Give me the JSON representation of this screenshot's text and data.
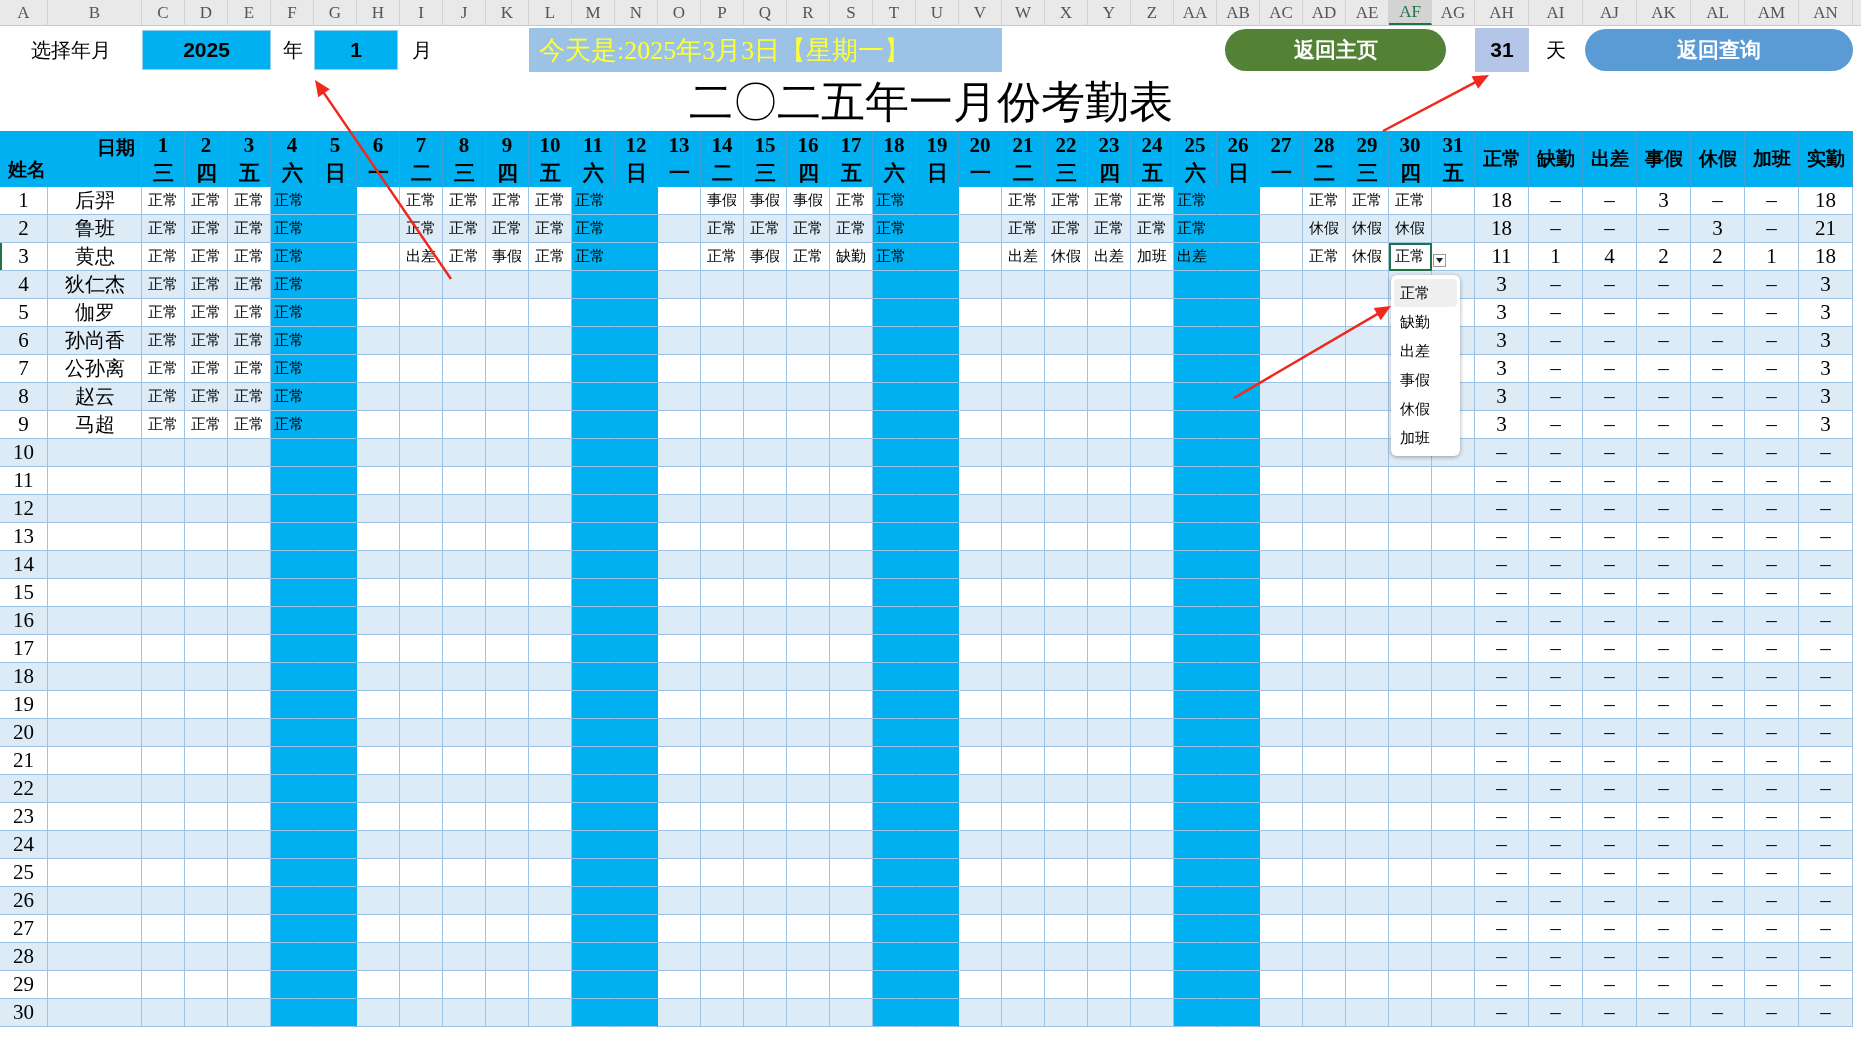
{
  "column_letters": [
    {
      "label": "A",
      "selected": false
    },
    {
      "label": "B",
      "selected": false
    },
    {
      "label": "C",
      "selected": false
    },
    {
      "label": "D",
      "selected": false
    },
    {
      "label": "E",
      "selected": false
    },
    {
      "label": "F",
      "selected": false
    },
    {
      "label": "G",
      "selected": false
    },
    {
      "label": "H",
      "selected": false
    },
    {
      "label": "I",
      "selected": false
    },
    {
      "label": "J",
      "selected": false
    },
    {
      "label": "K",
      "selected": false
    },
    {
      "label": "L",
      "selected": false
    },
    {
      "label": "M",
      "selected": false
    },
    {
      "label": "N",
      "selected": false
    },
    {
      "label": "O",
      "selected": false
    },
    {
      "label": "P",
      "selected": false
    },
    {
      "label": "Q",
      "selected": false
    },
    {
      "label": "R",
      "selected": false
    },
    {
      "label": "S",
      "selected": false
    },
    {
      "label": "T",
      "selected": false
    },
    {
      "label": "U",
      "selected": false
    },
    {
      "label": "V",
      "selected": false
    },
    {
      "label": "W",
      "selected": false
    },
    {
      "label": "X",
      "selected": false
    },
    {
      "label": "Y",
      "selected": false
    },
    {
      "label": "Z",
      "selected": false
    },
    {
      "label": "AA",
      "selected": false
    },
    {
      "label": "AB",
      "selected": false
    },
    {
      "label": "AC",
      "selected": false
    },
    {
      "label": "AD",
      "selected": false
    },
    {
      "label": "AE",
      "selected": false
    },
    {
      "label": "AF",
      "selected": true
    },
    {
      "label": "AG",
      "selected": false
    },
    {
      "label": "AH",
      "selected": false
    },
    {
      "label": "AI",
      "selected": false
    },
    {
      "label": "AJ",
      "selected": false
    },
    {
      "label": "AK",
      "selected": false
    },
    {
      "label": "AL",
      "selected": false
    },
    {
      "label": "AM",
      "selected": false
    },
    {
      "label": "AN",
      "selected": false
    }
  ],
  "controls": {
    "label": "选择年月",
    "year": "2025",
    "year_unit": "年",
    "month": "1",
    "month_unit": "月",
    "today_banner": "今天是:2025年3月3日【星期一】",
    "home_button": "返回主页",
    "days_in_month": "31",
    "days_unit": "天",
    "query_button": "返回查询"
  },
  "title": "二〇二五年一月份考勤表",
  "table": {
    "corner_top": "日期",
    "corner_bottom": "姓名",
    "days": [
      {
        "day": "1",
        "weekday": "三",
        "weekend": false
      },
      {
        "day": "2",
        "weekday": "四",
        "weekend": false
      },
      {
        "day": "3",
        "weekday": "五",
        "weekend": false
      },
      {
        "day": "4",
        "weekday": "六",
        "weekend": true
      },
      {
        "day": "5",
        "weekday": "日",
        "weekend": true
      },
      {
        "day": "6",
        "weekday": "一",
        "weekend": false
      },
      {
        "day": "7",
        "weekday": "二",
        "weekend": false
      },
      {
        "day": "8",
        "weekday": "三",
        "weekend": false
      },
      {
        "day": "9",
        "weekday": "四",
        "weekend": false
      },
      {
        "day": "10",
        "weekday": "五",
        "weekend": false
      },
      {
        "day": "11",
        "weekday": "六",
        "weekend": true
      },
      {
        "day": "12",
        "weekday": "日",
        "weekend": true
      },
      {
        "day": "13",
        "weekday": "一",
        "weekend": false
      },
      {
        "day": "14",
        "weekday": "二",
        "weekend": false
      },
      {
        "day": "15",
        "weekday": "三",
        "weekend": false
      },
      {
        "day": "16",
        "weekday": "四",
        "weekend": false
      },
      {
        "day": "17",
        "weekday": "五",
        "weekend": false
      },
      {
        "day": "18",
        "weekday": "六",
        "weekend": true
      },
      {
        "day": "19",
        "weekday": "日",
        "weekend": true
      },
      {
        "day": "20",
        "weekday": "一",
        "weekend": false
      },
      {
        "day": "21",
        "weekday": "二",
        "weekend": false
      },
      {
        "day": "22",
        "weekday": "三",
        "weekend": false
      },
      {
        "day": "23",
        "weekday": "四",
        "weekend": false
      },
      {
        "day": "24",
        "weekday": "五",
        "weekend": false
      },
      {
        "day": "25",
        "weekday": "六",
        "weekend": true
      },
      {
        "day": "26",
        "weekday": "日",
        "weekend": true
      },
      {
        "day": "27",
        "weekday": "一",
        "weekend": false
      },
      {
        "day": "28",
        "weekday": "二",
        "weekend": false
      },
      {
        "day": "29",
        "weekday": "三",
        "weekend": false
      },
      {
        "day": "30",
        "weekday": "四",
        "weekend": false
      },
      {
        "day": "31",
        "weekday": "五",
        "weekend": false
      }
    ],
    "summary_columns": [
      "正常",
      "缺勤",
      "出差",
      "事假",
      "休假",
      "加班",
      "实勤"
    ],
    "rows": [
      {
        "no": "1",
        "name": "后羿",
        "selected": false,
        "marks": [
          {
            "kind": "status",
            "text": "正常"
          },
          {
            "kind": "status",
            "text": "正常"
          },
          {
            "kind": "status",
            "text": "正常"
          },
          {
            "kind": "status",
            "text": "正常"
          },
          {
            "kind": "blank"
          },
          {
            "kind": "blank"
          },
          {
            "kind": "status",
            "text": "正常"
          },
          {
            "kind": "status",
            "text": "正常"
          },
          {
            "kind": "status",
            "text": "正常"
          },
          {
            "kind": "status",
            "text": "正常"
          },
          {
            "kind": "status",
            "text": "正常"
          },
          {
            "kind": "blank"
          },
          {
            "kind": "blank"
          },
          {
            "kind": "status",
            "text": "事假"
          },
          {
            "kind": "status",
            "text": "事假"
          },
          {
            "kind": "status",
            "text": "事假"
          },
          {
            "kind": "status",
            "text": "正常"
          },
          {
            "kind": "status",
            "text": "正常"
          },
          {
            "kind": "blank"
          },
          {
            "kind": "blank"
          },
          {
            "kind": "status",
            "text": "正常"
          },
          {
            "kind": "status",
            "text": "正常"
          },
          {
            "kind": "status",
            "text": "正常"
          },
          {
            "kind": "status",
            "text": "正常"
          },
          {
            "kind": "status",
            "text": "正常"
          },
          {
            "kind": "blank"
          },
          {
            "kind": "blank"
          },
          {
            "kind": "status",
            "text": "正常"
          },
          {
            "kind": "status",
            "text": "正常"
          },
          {
            "kind": "status",
            "text": "正常"
          }
        ],
        "summary": [
          "18",
          "–",
          "–",
          "3",
          "–",
          "–",
          "18"
        ]
      },
      {
        "no": "2",
        "name": "鲁班",
        "selected": false,
        "marks": [
          {
            "kind": "status",
            "text": "正常"
          },
          {
            "kind": "status",
            "text": "正常"
          },
          {
            "kind": "status",
            "text": "正常"
          },
          {
            "kind": "status",
            "text": "正常"
          },
          {
            "kind": "blank"
          },
          {
            "kind": "blank"
          },
          {
            "kind": "status",
            "text": "正常"
          },
          {
            "kind": "status",
            "text": "正常"
          },
          {
            "kind": "status",
            "text": "正常"
          },
          {
            "kind": "status",
            "text": "正常"
          },
          {
            "kind": "status",
            "text": "正常"
          },
          {
            "kind": "blank"
          },
          {
            "kind": "blank"
          },
          {
            "kind": "status",
            "text": "正常"
          },
          {
            "kind": "status",
            "text": "正常"
          },
          {
            "kind": "status",
            "text": "正常"
          },
          {
            "kind": "status",
            "text": "正常"
          },
          {
            "kind": "status",
            "text": "正常"
          },
          {
            "kind": "blank"
          },
          {
            "kind": "blank"
          },
          {
            "kind": "status",
            "text": "正常"
          },
          {
            "kind": "status",
            "text": "正常"
          },
          {
            "kind": "status",
            "text": "正常"
          },
          {
            "kind": "status",
            "text": "正常"
          },
          {
            "kind": "status",
            "text": "正常"
          },
          {
            "kind": "blank"
          },
          {
            "kind": "blank"
          },
          {
            "kind": "status",
            "text": "休假"
          },
          {
            "kind": "status",
            "text": "休假"
          },
          {
            "kind": "status",
            "text": "休假"
          }
        ],
        "summary": [
          "18",
          "–",
          "–",
          "–",
          "3",
          "–",
          "21"
        ]
      },
      {
        "no": "3",
        "name": "黄忠",
        "selected": true,
        "marks": [
          {
            "kind": "status",
            "text": "正常"
          },
          {
            "kind": "status",
            "text": "正常"
          },
          {
            "kind": "status",
            "text": "正常"
          },
          {
            "kind": "status",
            "text": "正常"
          },
          {
            "kind": "blank"
          },
          {
            "kind": "blank"
          },
          {
            "kind": "status",
            "text": "出差"
          },
          {
            "kind": "status",
            "text": "正常"
          },
          {
            "kind": "status",
            "text": "事假"
          },
          {
            "kind": "status",
            "text": "正常"
          },
          {
            "kind": "status",
            "text": "正常"
          },
          {
            "kind": "blank"
          },
          {
            "kind": "blank"
          },
          {
            "kind": "status",
            "text": "正常"
          },
          {
            "kind": "status",
            "text": "事假"
          },
          {
            "kind": "status",
            "text": "正常"
          },
          {
            "kind": "status",
            "text": "缺勤"
          },
          {
            "kind": "status",
            "text": "正常"
          },
          {
            "kind": "blank"
          },
          {
            "kind": "blank"
          },
          {
            "kind": "status",
            "text": "出差"
          },
          {
            "kind": "status",
            "text": "休假"
          },
          {
            "kind": "status",
            "text": "出差"
          },
          {
            "kind": "status",
            "text": "加班"
          },
          {
            "kind": "status",
            "text": "出差"
          },
          {
            "kind": "blank"
          },
          {
            "kind": "blank"
          },
          {
            "kind": "status",
            "text": "正常"
          },
          {
            "kind": "status",
            "text": "休假"
          },
          {
            "kind": "status",
            "text": "正常"
          }
        ],
        "summary": [
          "11",
          "1",
          "4",
          "2",
          "2",
          "1",
          "18"
        ]
      },
      {
        "no": "4",
        "name": "狄仁杰",
        "selected": false,
        "marks": [
          {
            "kind": "status",
            "text": "正常"
          },
          {
            "kind": "status",
            "text": "正常"
          },
          {
            "kind": "status",
            "text": "正常"
          },
          {
            "kind": "status",
            "text": "正常"
          }
        ],
        "summary": [
          "3",
          "–",
          "–",
          "–",
          "–",
          "–",
          "3"
        ]
      },
      {
        "no": "5",
        "name": "伽罗",
        "selected": false,
        "marks": [
          {
            "kind": "status",
            "text": "正常"
          },
          {
            "kind": "status",
            "text": "正常"
          },
          {
            "kind": "status",
            "text": "正常"
          },
          {
            "kind": "status",
            "text": "正常"
          }
        ],
        "summary": [
          "3",
          "–",
          "–",
          "–",
          "–",
          "–",
          "3"
        ]
      },
      {
        "no": "6",
        "name": "孙尚香",
        "selected": false,
        "marks": [
          {
            "kind": "status",
            "text": "正常"
          },
          {
            "kind": "status",
            "text": "正常"
          },
          {
            "kind": "status",
            "text": "正常"
          },
          {
            "kind": "status",
            "text": "正常"
          }
        ],
        "summary": [
          "3",
          "–",
          "–",
          "–",
          "–",
          "–",
          "3"
        ]
      },
      {
        "no": "7",
        "name": "公孙离",
        "selected": false,
        "marks": [
          {
            "kind": "status",
            "text": "正常"
          },
          {
            "kind": "status",
            "text": "正常"
          },
          {
            "kind": "status",
            "text": "正常"
          },
          {
            "kind": "status",
            "text": "正常"
          }
        ],
        "summary": [
          "3",
          "–",
          "–",
          "–",
          "–",
          "–",
          "3"
        ]
      },
      {
        "no": "8",
        "name": "赵云",
        "selected": false,
        "marks": [
          {
            "kind": "status",
            "text": "正常"
          },
          {
            "kind": "status",
            "text": "正常"
          },
          {
            "kind": "status",
            "text": "正常"
          },
          {
            "kind": "status",
            "text": "正常"
          }
        ],
        "summary": [
          "3",
          "–",
          "–",
          "–",
          "–",
          "–",
          "3"
        ]
      },
      {
        "no": "9",
        "name": "马超",
        "selected": false,
        "marks": [
          {
            "kind": "status",
            "text": "正常"
          },
          {
            "kind": "status",
            "text": "正常"
          },
          {
            "kind": "status",
            "text": "正常"
          },
          {
            "kind": "status",
            "text": "正常"
          }
        ],
        "summary": [
          "3",
          "–",
          "–",
          "–",
          "–",
          "–",
          "3"
        ]
      },
      {
        "no": "10",
        "selected": false,
        "summary": [
          "–",
          "–",
          "–",
          "–",
          "–",
          "–",
          "–"
        ]
      },
      {
        "no": "11",
        "selected": false,
        "summary": [
          "–",
          "–",
          "–",
          "–",
          "–",
          "–",
          "–"
        ]
      },
      {
        "no": "12",
        "selected": false,
        "summary": [
          "–",
          "–",
          "–",
          "–",
          "–",
          "–",
          "–"
        ]
      },
      {
        "no": "13",
        "selected": false,
        "summary": [
          "–",
          "–",
          "–",
          "–",
          "–",
          "–",
          "–"
        ]
      },
      {
        "no": "14",
        "selected": false,
        "summary": [
          "–",
          "–",
          "–",
          "–",
          "–",
          "–",
          "–"
        ]
      },
      {
        "no": "15",
        "selected": false,
        "summary": [
          "–",
          "–",
          "–",
          "–",
          "–",
          "–",
          "–"
        ]
      },
      {
        "no": "16",
        "selected": false,
        "summary": [
          "–",
          "–",
          "–",
          "–",
          "–",
          "–",
          "–"
        ]
      },
      {
        "no": "17",
        "selected": false,
        "summary": [
          "–",
          "–",
          "–",
          "–",
          "–",
          "–",
          "–"
        ]
      },
      {
        "no": "18",
        "selected": false,
        "summary": [
          "–",
          "–",
          "–",
          "–",
          "–",
          "–",
          "–"
        ]
      },
      {
        "no": "19",
        "selected": false,
        "summary": [
          "–",
          "–",
          "–",
          "–",
          "–",
          "–",
          "–"
        ]
      },
      {
        "no": "20",
        "selected": false,
        "summary": [
          "–",
          "–",
          "–",
          "–",
          "–",
          "–",
          "–"
        ]
      },
      {
        "no": "21",
        "selected": false,
        "summary": [
          "–",
          "–",
          "–",
          "–",
          "–",
          "–",
          "–"
        ]
      },
      {
        "no": "22",
        "selected": false,
        "summary": [
          "–",
          "–",
          "–",
          "–",
          "–",
          "–",
          "–"
        ]
      },
      {
        "no": "23",
        "selected": false,
        "summary": [
          "–",
          "–",
          "–",
          "–",
          "–",
          "–",
          "–"
        ]
      },
      {
        "no": "24",
        "selected": false,
        "summary": [
          "–",
          "–",
          "–",
          "–",
          "–",
          "–",
          "–"
        ]
      },
      {
        "no": "25",
        "selected": false,
        "summary": [
          "–",
          "–",
          "–",
          "–",
          "–",
          "–",
          "–"
        ]
      },
      {
        "no": "26",
        "selected": false,
        "summary": [
          "–",
          "–",
          "–",
          "–",
          "–",
          "–",
          "–"
        ]
      },
      {
        "no": "27",
        "selected": false,
        "summary": [
          "–",
          "–",
          "–",
          "–",
          "–",
          "–",
          "–"
        ]
      },
      {
        "no": "28",
        "selected": false,
        "summary": [
          "–",
          "–",
          "–",
          "–",
          "–",
          "–",
          "–"
        ]
      },
      {
        "no": "29",
        "selected": false,
        "summary": [
          "–",
          "–",
          "–",
          "–",
          "–",
          "–",
          "–"
        ]
      },
      {
        "no": "30",
        "selected": false,
        "summary": [
          "–",
          "–",
          "–",
          "–",
          "–",
          "–",
          "–"
        ]
      }
    ]
  },
  "dropdown": {
    "options": [
      {
        "label": "正常",
        "selected": true
      },
      {
        "label": "缺勤",
        "selected": false
      },
      {
        "label": "出差",
        "selected": false
      },
      {
        "label": "事假",
        "selected": false
      },
      {
        "label": "休假",
        "selected": false
      },
      {
        "label": "加班",
        "selected": false
      }
    ]
  }
}
